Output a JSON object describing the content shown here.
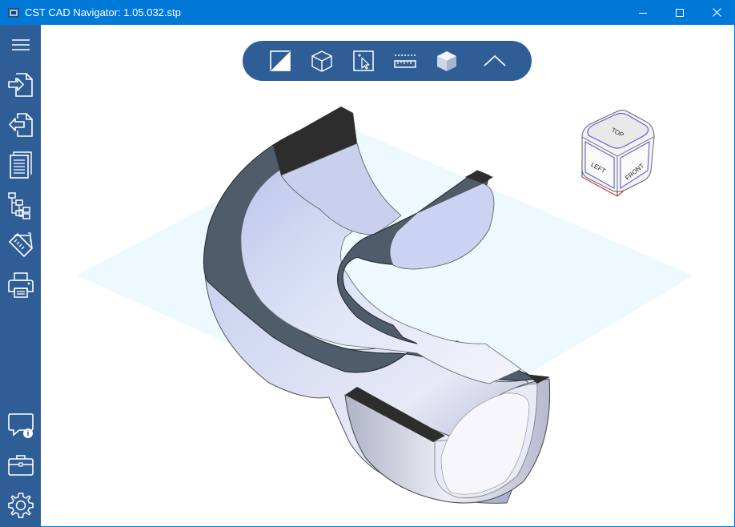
{
  "window": {
    "title": "CST CAD Navigator: 1.05.032.stp",
    "icon": "cst-app-icon",
    "buttons": [
      "minimize-icon",
      "maximize-icon",
      "close-icon"
    ]
  },
  "sidebar": {
    "top_items": [
      "hamburger-menu-icon",
      "import-icon",
      "export-icon",
      "document-icon",
      "tree-structure-icon",
      "measure-notes-icon",
      "print-icon"
    ],
    "bottom_items": [
      "feedback-info-icon",
      "toolbox-icon",
      "settings-gear-icon"
    ]
  },
  "toolbar": {
    "items": [
      "section-cut-icon",
      "wireframe-box-icon",
      "select-icon",
      "ruler-icon",
      "shaded-box-icon",
      "collapse-chevron-icon"
    ]
  },
  "viewcube": {
    "faces": {
      "top": "TOP",
      "left": "LEFT",
      "front": "FRONT"
    }
  },
  "colors": {
    "titlebar": "#0078d7",
    "sidebar": "#2f5e97",
    "toolbar": "#2f5e97",
    "section_plane": "#eaf8ff",
    "cut_face": "#4f5c6c",
    "pipe_surface": "#c9d2ef"
  }
}
